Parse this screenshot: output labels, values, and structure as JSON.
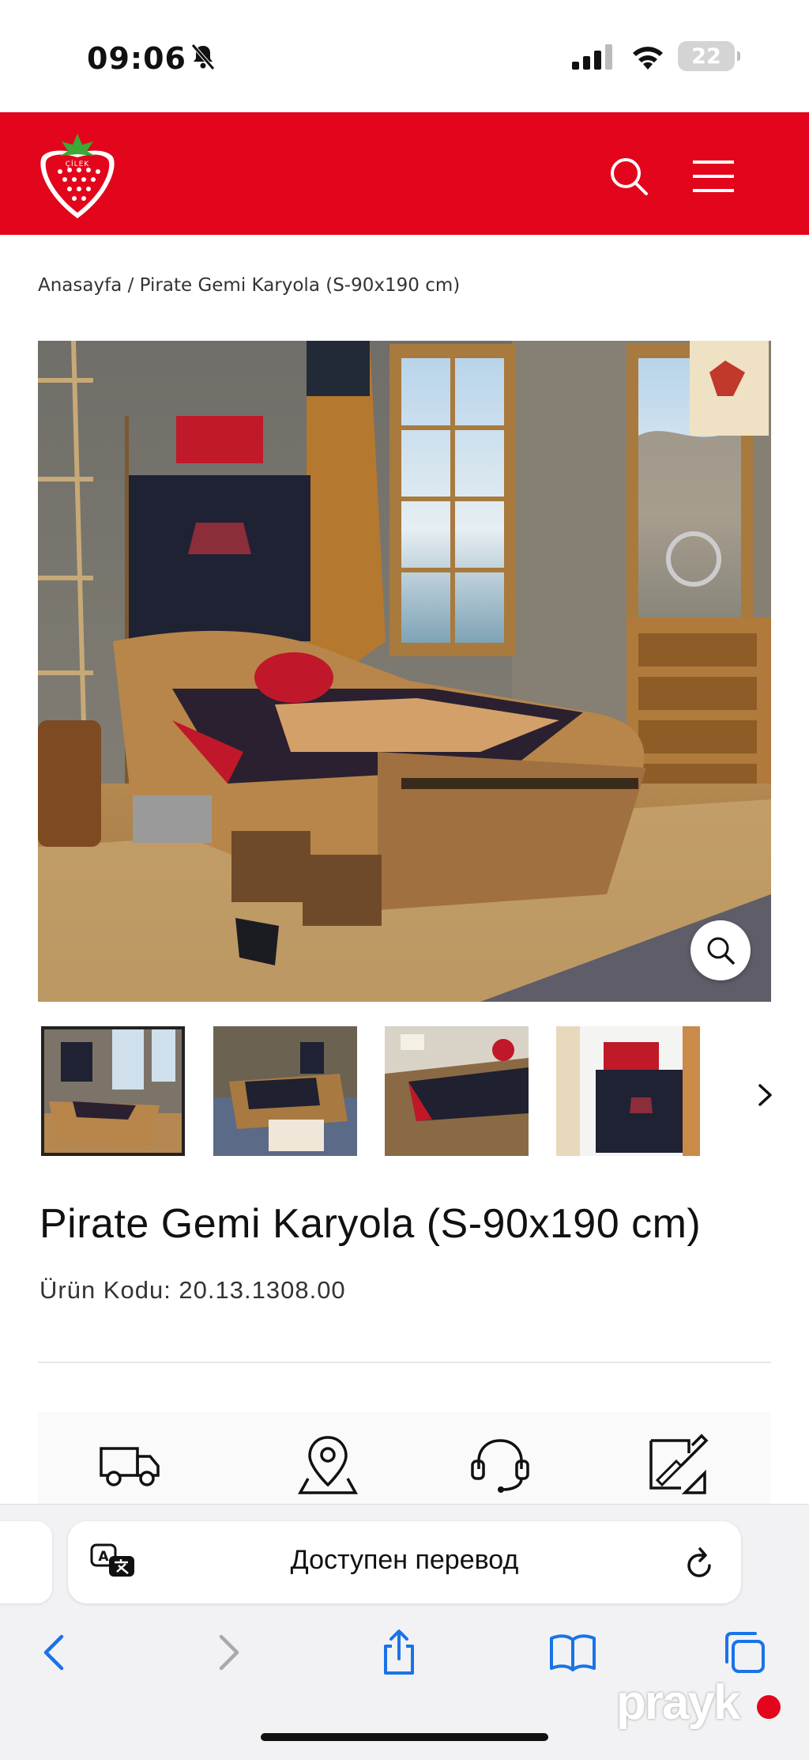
{
  "status_bar": {
    "time": "09:06",
    "battery": "22"
  },
  "header": {
    "logo_text": "ÇİLEK"
  },
  "breadcrumb": "Anasayfa / Pirate Gemi Karyola (S-90x190 cm)",
  "product": {
    "title": "Pirate Gemi Karyola (S-90x190 cm)",
    "code": "Ürün Kodu: 20.13.1308.00"
  },
  "hero": {
    "watermark": "prayk"
  },
  "safari": {
    "address_text": "Доступен перевод"
  },
  "watermark": "prayk",
  "colors": {
    "brand_red": "#e3051b"
  }
}
